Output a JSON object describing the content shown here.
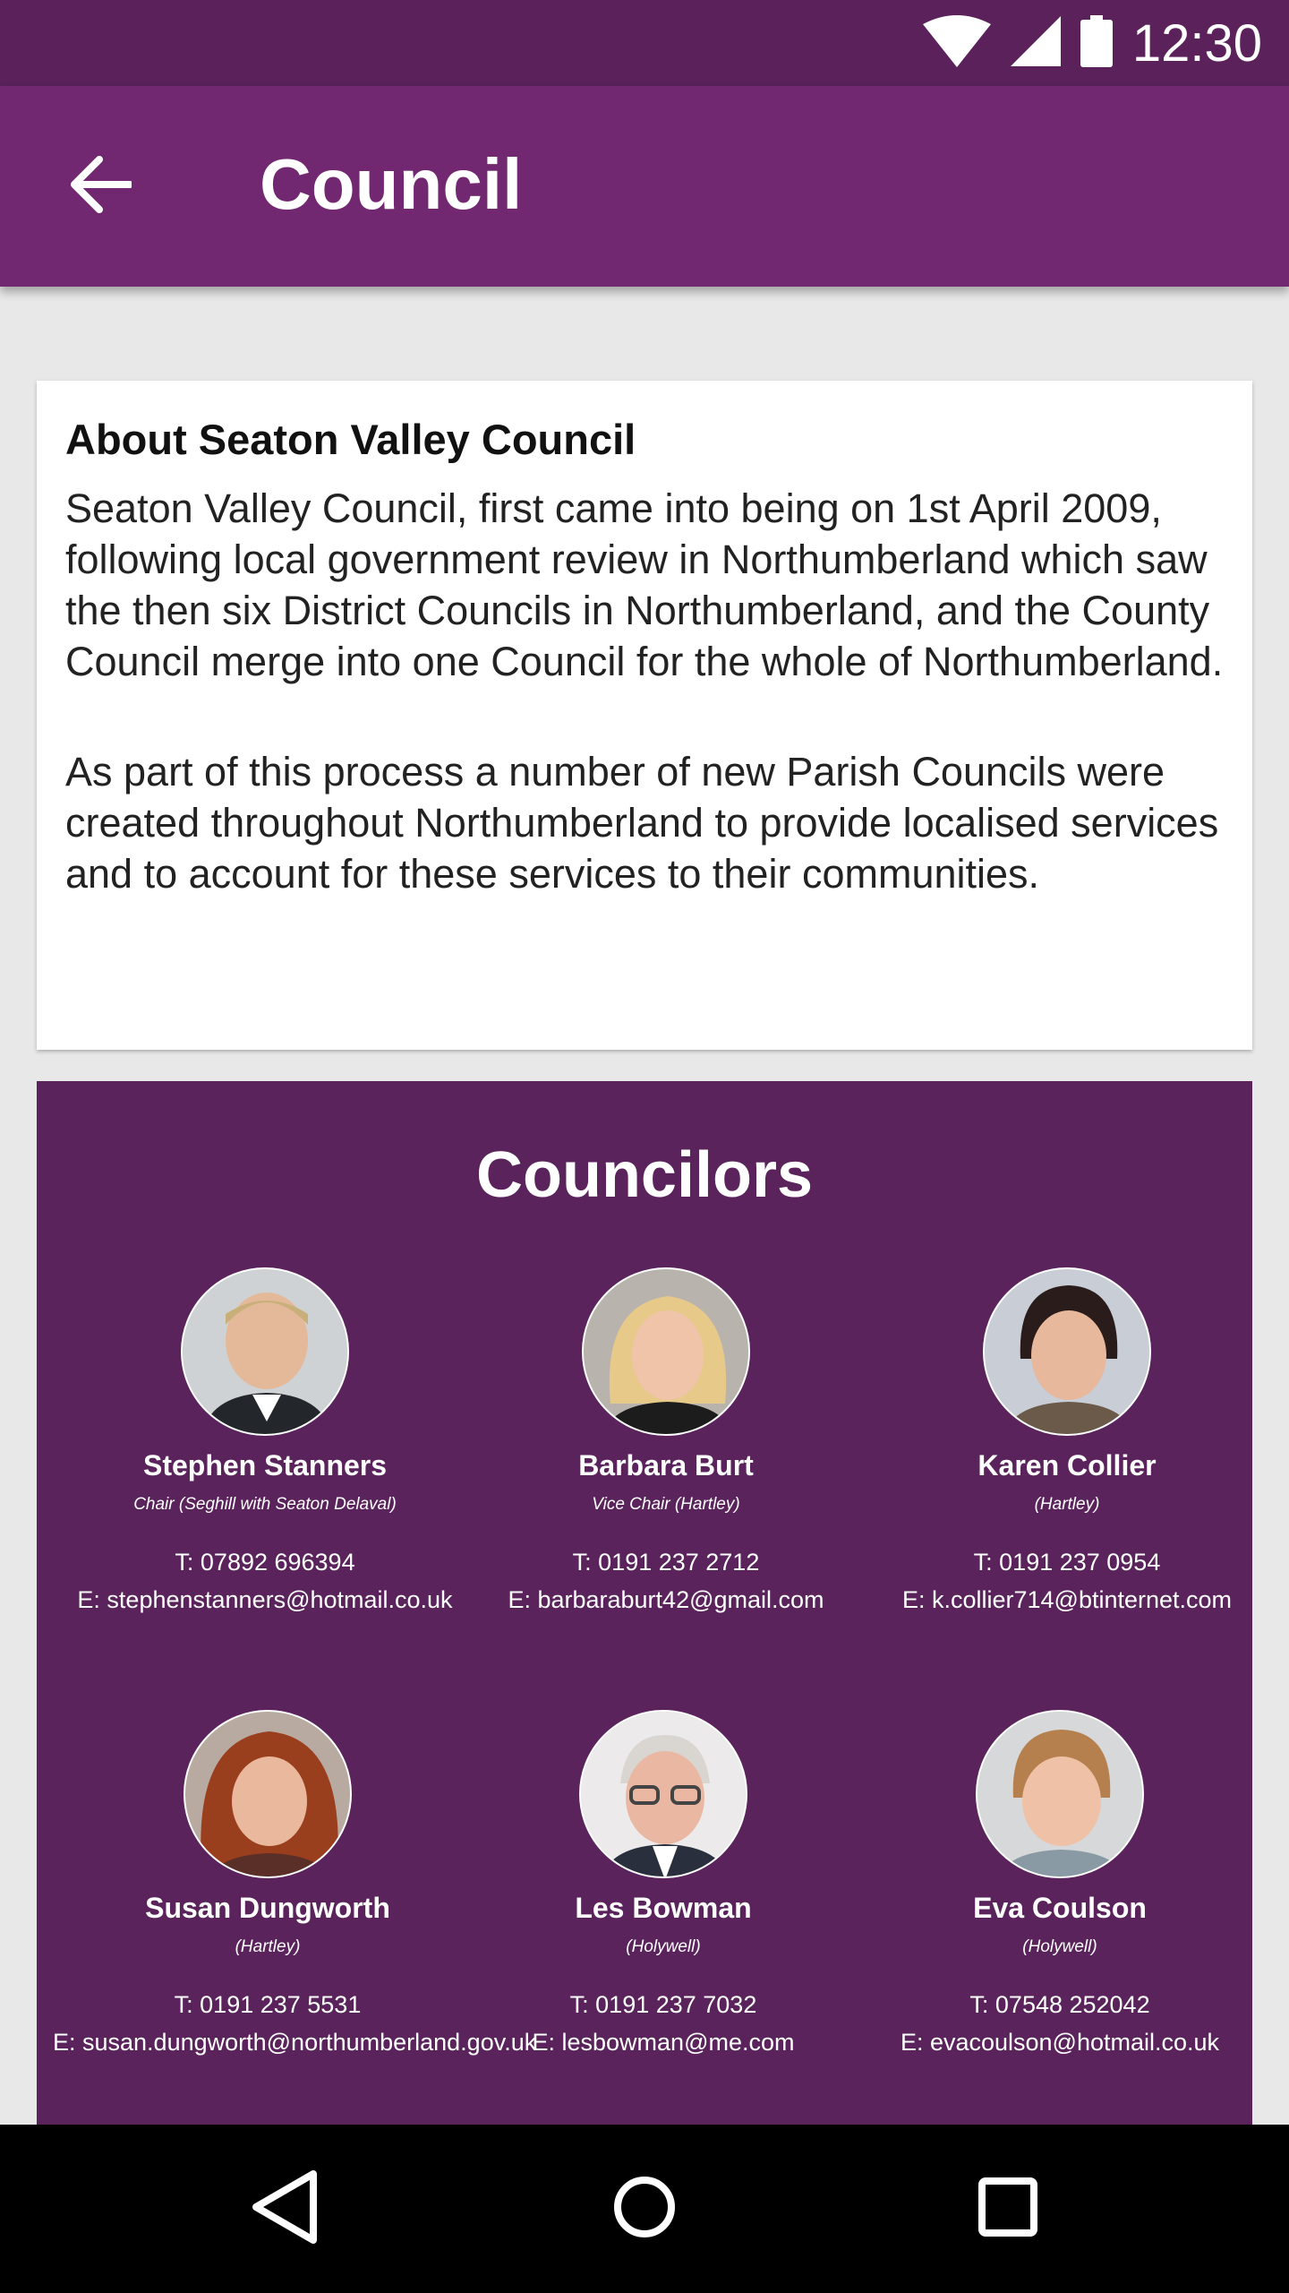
{
  "status_bar": {
    "time": "12:30"
  },
  "app_bar": {
    "title": "Council"
  },
  "about": {
    "title": "About Seaton Valley Council",
    "paragraph1": "Seaton Valley Council, first came into being on 1st April 2009, following local government review in Northumberland which saw the then six District Councils in Northumberland, and the County Council merge into one Council for the whole of Northumberland.",
    "paragraph2": "As part of this process a number of new Parish Councils were created throughout Northumberland to provide localised services and to account for these services to their communities."
  },
  "councilors": {
    "title": "Councilors",
    "people": [
      {
        "name": "Stephen Stanners",
        "role": "Chair (Seghill with Seaton Delaval)",
        "phone": "T: 07892 696394",
        "email": "E: stephenstanners@hotmail.co.uk"
      },
      {
        "name": "Barbara Burt",
        "role": "Vice Chair (Hartley)",
        "phone": "T: 0191 237 2712",
        "email": "E: barbaraburt42@gmail.com"
      },
      {
        "name": "Karen Collier",
        "role": "(Hartley)",
        "phone": "T: 0191 237 0954",
        "email": "E: k.collier714@btinternet.com"
      },
      {
        "name": "Susan Dungworth",
        "role": "(Hartley)",
        "phone": "T: 0191 237 5531",
        "email": "E: susan.dungworth@northumberland.gov.uk"
      },
      {
        "name": "Les Bowman",
        "role": "(Holywell)",
        "phone": "T: 0191 237 7032",
        "email": "E: lesbowman@me.com"
      },
      {
        "name": "Eva Coulson",
        "role": "(Holywell)",
        "phone": "T: 07548 252042",
        "email": "E: evacoulson@hotmail.co.uk"
      }
    ]
  },
  "icons": {
    "status": [
      "wifi-icon",
      "cell-signal-icon",
      "battery-icon"
    ],
    "app_bar": "arrow-back-icon",
    "nav": [
      "nav-back-icon",
      "nav-home-icon",
      "nav-recents-icon"
    ]
  },
  "colors": {
    "status_bar": "#5a215a",
    "app_bar": "#722870",
    "councilors_bg": "#5a235c",
    "page_bg": "#e8e8e8"
  }
}
